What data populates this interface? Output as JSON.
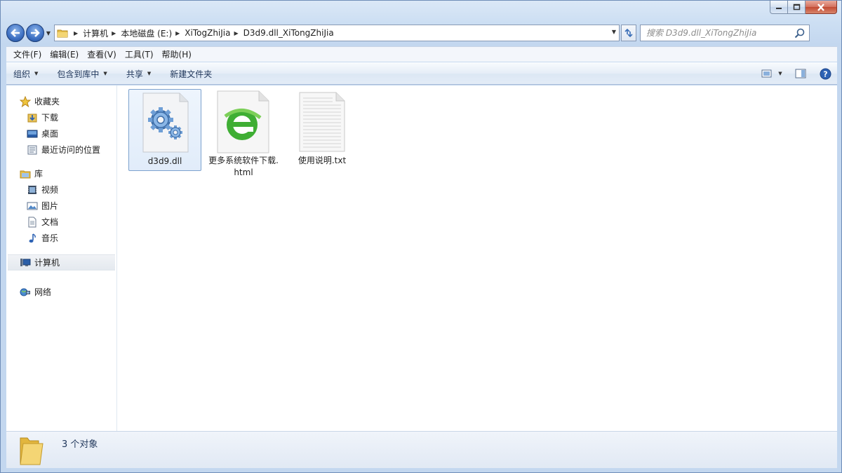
{
  "navigation": {
    "breadcrumb": [
      "计算机",
      "本地磁盘 (E:)",
      "XiTogZhiJia",
      "D3d9.dll_XiTongZhiJia"
    ],
    "search_placeholder": "搜索 D3d9.dll_XiTongZhiJia"
  },
  "menu": [
    "文件(F)",
    "编辑(E)",
    "查看(V)",
    "工具(T)",
    "帮助(H)"
  ],
  "toolbar": {
    "organize": "组织",
    "include_library": "包含到库中",
    "share": "共享",
    "new_folder": "新建文件夹"
  },
  "sidebar": {
    "favorites": {
      "label": "收藏夹",
      "items": [
        "下载",
        "桌面",
        "最近访问的位置"
      ]
    },
    "libraries": {
      "label": "库",
      "items": [
        "视频",
        "图片",
        "文档",
        "音乐"
      ]
    },
    "computer": "计算机",
    "network": "网络"
  },
  "files": [
    {
      "name": "d3d9.dll",
      "icon": "gear-file-icon"
    },
    {
      "name": "更多系统软件下载.html",
      "icon": "browser-e-icon"
    },
    {
      "name": "使用说明.txt",
      "icon": "text-file-icon"
    }
  ],
  "status": {
    "count_text": "3 个对象"
  }
}
